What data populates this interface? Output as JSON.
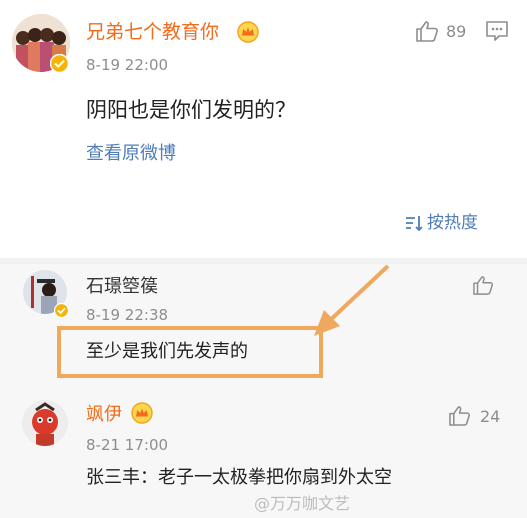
{
  "top_comment": {
    "username": "兄弟七个教育你",
    "timestamp": "8-19 22:00",
    "text": "阴阳也是你们发明的？",
    "view_original": "查看原微博",
    "like_count": "89",
    "avatar_icon": "group-avatar-icon",
    "badge_icon": "crown-badge-icon"
  },
  "sort": {
    "label": "按热度",
    "icon": "sort-icon"
  },
  "replies": [
    {
      "username": "石璟箜篌",
      "timestamp": "8-19 22:38",
      "text": "至少是我们先发声的",
      "like_count": "",
      "highlighted": true
    },
    {
      "username": "飒伊",
      "timestamp": "8-21 17:00",
      "text": "张三丰：老子一太极拳把你扇到外太空",
      "like_count": "24"
    }
  ],
  "watermark": "@万万咖文艺",
  "colors": {
    "accent_orange": "#f26c1c",
    "link_blue": "#4f7db8",
    "highlight_orange": "#f0a85e"
  }
}
